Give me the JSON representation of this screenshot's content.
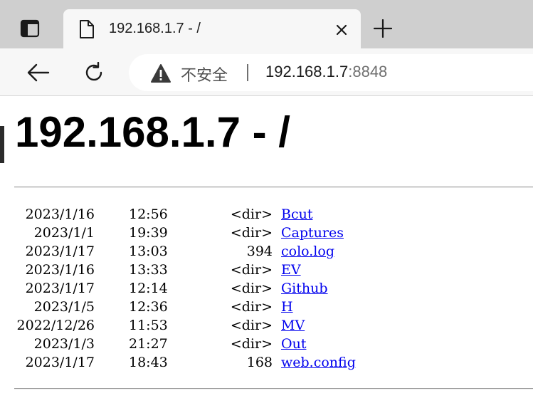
{
  "browser": {
    "tab": {
      "title": "192.168.1.7 - /"
    },
    "address_bar": {
      "security_label": "不安全",
      "separator": "|",
      "host": "192.168.1.7",
      "port": ":8848"
    },
    "icons": {
      "tab_actions": "tab-actions-icon",
      "favicon": "document-icon",
      "close": "close-icon",
      "new_tab": "plus-icon",
      "back": "back-arrow-icon",
      "refresh": "refresh-icon",
      "warning": "warning-icon"
    }
  },
  "page": {
    "title": "192.168.1.7 - /",
    "entries": [
      {
        "date": "2023/1/16",
        "time": "12:56",
        "size": "<dir>",
        "name": "Bcut"
      },
      {
        "date": "2023/1/1",
        "time": "19:39",
        "size": "<dir>",
        "name": "Captures"
      },
      {
        "date": "2023/1/17",
        "time": "13:03",
        "size": "394",
        "name": "colo.log"
      },
      {
        "date": "2023/1/16",
        "time": "13:33",
        "size": "<dir>",
        "name": "EV"
      },
      {
        "date": "2023/1/17",
        "time": "12:14",
        "size": "<dir>",
        "name": "Github"
      },
      {
        "date": "2023/1/5",
        "time": "12:36",
        "size": "<dir>",
        "name": "H"
      },
      {
        "date": "2022/12/26",
        "time": "11:53",
        "size": "<dir>",
        "name": "MV"
      },
      {
        "date": "2023/1/3",
        "time": "21:27",
        "size": "<dir>",
        "name": "Out"
      },
      {
        "date": "2023/1/17",
        "time": "18:43",
        "size": "168",
        "name": "web.config"
      }
    ]
  },
  "colors": {
    "tabstrip_bg": "#cfcfcf",
    "toolbar_bg": "#f7f7f7",
    "link": "#0000ee"
  }
}
